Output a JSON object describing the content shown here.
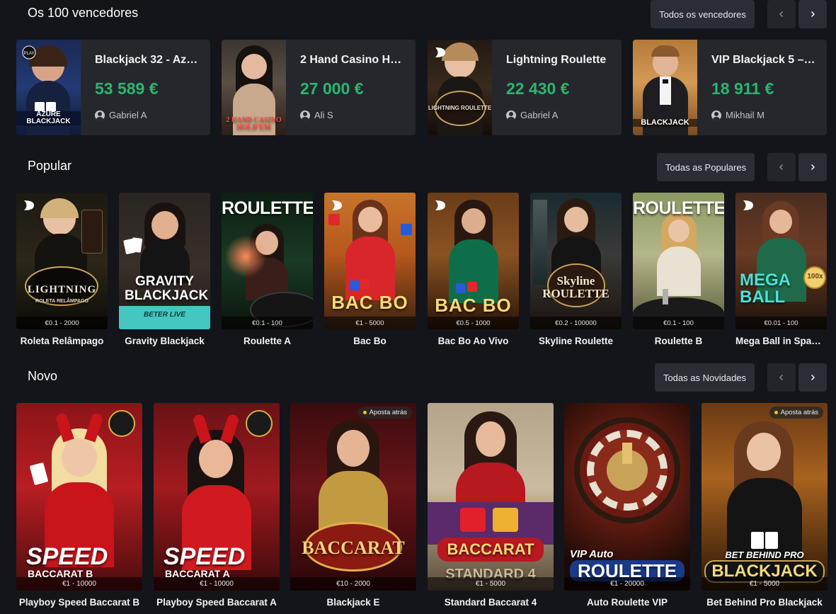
{
  "sections": {
    "winners": {
      "title": "Os 100 vencedores",
      "all_label": "Todos os vencedores",
      "items": [
        {
          "name": "Blackjack 32 - Az…",
          "amount": "53 589 €",
          "user": "Gabriel A",
          "art": "AZURE BLACKJACK"
        },
        {
          "name": "2 Hand Casino Ho…",
          "amount": "27 000 €",
          "user": "Ali S",
          "art": "2 HAND CASINO HOLD'EM"
        },
        {
          "name": "Lightning Roulette",
          "amount": "22 430 €",
          "user": "Gabriel A",
          "art": "LIGHTNING ROULETTE"
        },
        {
          "name": "VIP Blackjack 5 – …",
          "amount": "18 911 €",
          "user": "Mikhail M",
          "art": "BLACKJACK"
        }
      ]
    },
    "popular": {
      "title": "Popular",
      "all_label": "Todas as Populares",
      "items": [
        {
          "name": "Roleta Relâmpago",
          "limits": "€0.1 - 2000",
          "art": "LIGHTNING",
          "art2": "ROLETA RELÂMPAGO"
        },
        {
          "name": "Gravity Blackjack",
          "limits": "",
          "art": "GRAVITY BLACKJACK",
          "art2": "BETER LIVE"
        },
        {
          "name": "Roulette A",
          "limits": "€0.1 - 100",
          "art": "ROULETTE",
          "art2": ""
        },
        {
          "name": "Bac Bo",
          "limits": "€1 - 5000",
          "art": "BAC BO",
          "art2": ""
        },
        {
          "name": "Bac Bo Ao Vivo",
          "limits": "€0.5 - 1000",
          "art": "BAC BO",
          "art2": ""
        },
        {
          "name": "Skyline Roulette",
          "limits": "€0.2 - 100000",
          "art": "Skyline ROULETTE",
          "art2": ""
        },
        {
          "name": "Roulette B",
          "limits": "€0.1 - 100",
          "art": "ROULETTE",
          "art2": ""
        },
        {
          "name": "Mega Ball in Span…",
          "limits": "€0.01 - 100",
          "art": "MEGA BALL",
          "art2": "100x"
        }
      ]
    },
    "new": {
      "title": "Novo",
      "all_label": "Todas as Novidades",
      "bet_behind_label": "Aposta atrás",
      "items": [
        {
          "name": "Playboy Speed Baccarat B",
          "limits": "€1 - 10000",
          "art": "SPEED",
          "art2": "BACCARAT B"
        },
        {
          "name": "Playboy Speed Baccarat A",
          "limits": "€1 - 10000",
          "art": "SPEED",
          "art2": "BACCARAT A"
        },
        {
          "name": "Blackjack E",
          "limits": "€10 - 2000",
          "art": "BACCARAT",
          "art2": ""
        },
        {
          "name": "Standard Baccarat 4",
          "limits": "€1 - 5000",
          "art": "BACCARAT",
          "art2": "STANDARD 4"
        },
        {
          "name": "Auto Roulette VIP",
          "limits": "€1 - 20000",
          "art": "VIP Auto",
          "art2": "ROULETTE"
        },
        {
          "name": "Bet Behind Pro Blackjack",
          "limits": "€1 - 5000",
          "art": "BET BEHIND PRO",
          "art2": "BLACKJACK"
        }
      ]
    }
  },
  "colors": {
    "background": "#13151a",
    "card": "#25272d",
    "amount_green": "#2cb66f",
    "button": "#2a2d34"
  }
}
